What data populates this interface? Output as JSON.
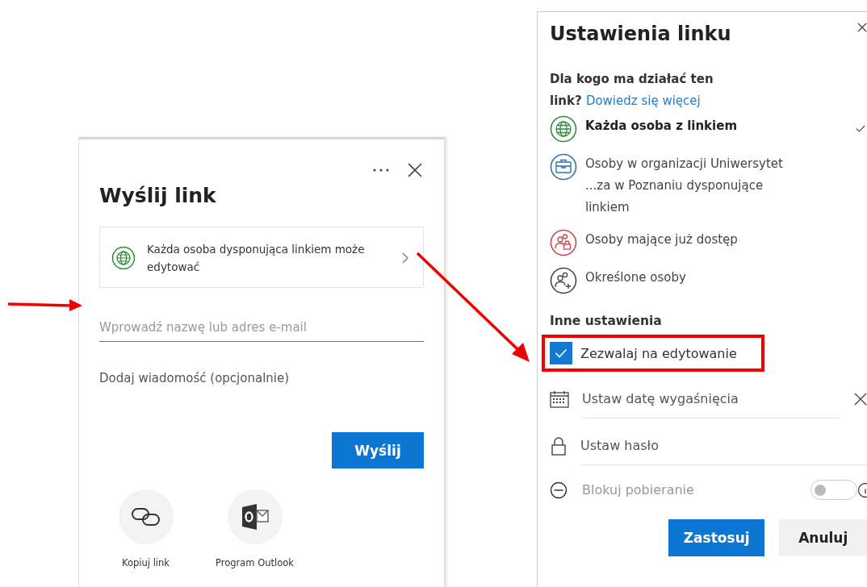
{
  "send_link": {
    "title": "Wyślij link",
    "permission": "Każda osoba dysponująca linkiem może edytować",
    "recipient_placeholder": "Wprowadź nazwę lub adres e-mail",
    "message_placeholder": "Dodaj wiadomość (opcjonalnie)",
    "send_button": "Wyślij",
    "share_options": [
      {
        "kind": "copy",
        "label": "Kopiuj link"
      },
      {
        "kind": "outlook",
        "label": "Program Outlook"
      }
    ]
  },
  "link_settings": {
    "title": "Ustawienia linku",
    "question": "Dla kogo ma działać ten link?",
    "learn_more": "Dowiedz się więcej",
    "audiences": [
      {
        "kind": "anyone",
        "label": "Każda osoba z linkiem",
        "selected": true
      },
      {
        "kind": "organization",
        "label": "Osoby w organizacji Uniwersytet ...za w Poznaniu dysponujące linkiem",
        "selected": false
      },
      {
        "kind": "existing",
        "label": "Osoby mające już dostęp",
        "selected": false
      },
      {
        "kind": "specific",
        "label": "Określone osoby",
        "selected": false
      }
    ],
    "other_heading": "Inne ustawienia",
    "allow_edit": {
      "label": "Zezwalaj na edytowanie",
      "checked": true
    },
    "expiry_placeholder": "Ustaw datę wygaśnięcia",
    "password_placeholder": "Ustaw hasło",
    "block_download": {
      "label": "Blokuj pobieranie",
      "on": false,
      "disabled": true
    },
    "apply_button": "Zastosuj",
    "cancel_button": "Anuluj"
  }
}
